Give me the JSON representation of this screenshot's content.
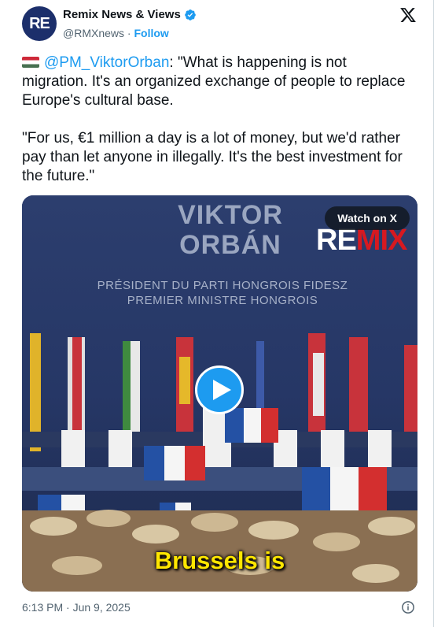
{
  "author": {
    "avatar_text": "RE",
    "display_name": "Remix News & Views",
    "handle": "@RMXnews",
    "separator": "·",
    "follow_label": "Follow"
  },
  "tweet": {
    "mention": "@PM_ViktorOrban",
    "paragraph1_rest": ": \"What is happening is not migration. It's an organized exchange of people to replace Europe's cultural base.",
    "paragraph2": "\"For us, €1 million a day is a lot of money, but we'd rather pay than let anyone in illegally. It's the best investment for the future.\""
  },
  "media": {
    "watch_label": "Watch on X",
    "overlay_name_line1": "VIKTOR",
    "overlay_name_line2": "ORBÁN",
    "overlay_sub_line1": "PRÉSIDENT DU PARTI HONGROIS FIDESZ",
    "overlay_sub_line2": "PREMIER MINISTRE HONGROIS",
    "brand_re": "RE",
    "brand_mix": "MIX",
    "caption": "Brussels is"
  },
  "footer": {
    "timestamp": "6:13 PM · Jun 9, 2025"
  },
  "icons": {
    "verified": "verified-badge-icon",
    "x_logo": "x-logo-icon",
    "play": "play-icon",
    "info": "info-icon",
    "flag": "hungary-flag-icon"
  },
  "colors": {
    "accent": "#1d9bf0",
    "text": "#0f1419",
    "muted": "#536471",
    "caption": "#ffe600"
  }
}
